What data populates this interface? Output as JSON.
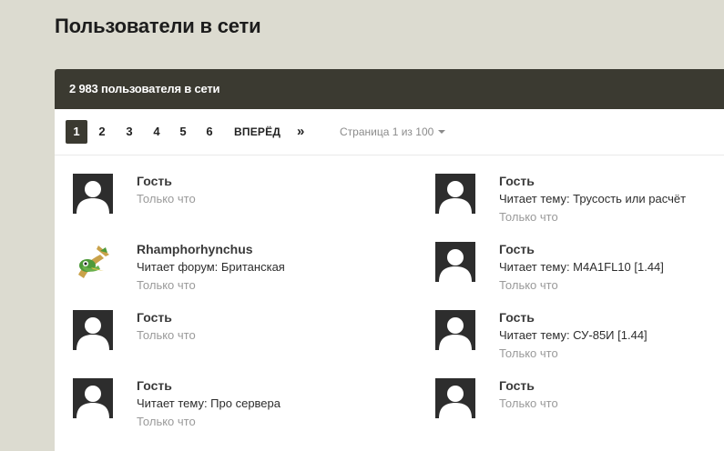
{
  "page_title": "Пользователи в сети",
  "panel": {
    "header": "2 983 пользователя в сети"
  },
  "pagination": {
    "pages": [
      "1",
      "2",
      "3",
      "4",
      "5",
      "6"
    ],
    "active_page": "1",
    "next_label": "ВПЕРЁД",
    "last_label": "»",
    "page_info": "Страница 1 из 100"
  },
  "users": [
    {
      "name": "Гость",
      "activity": "",
      "time": "Только что",
      "avatar": "default-avatar"
    },
    {
      "name": "Гость",
      "activity": "Читает тему: Трусость или расчёт",
      "time": "Только что",
      "avatar": "default-avatar"
    },
    {
      "name": "Rhamphorhynchus",
      "activity": "Читает форум: Британская",
      "time": "Только что",
      "avatar": "custom-avatar"
    },
    {
      "name": "Гость",
      "activity": "Читает тему: M4A1FL10 [1.44]",
      "time": "Только что",
      "avatar": "default-avatar"
    },
    {
      "name": "Гость",
      "activity": "",
      "time": "Только что",
      "avatar": "default-avatar"
    },
    {
      "name": "Гость",
      "activity": "Читает тему: СУ-85И [1.44]",
      "time": "Только что",
      "avatar": "default-avatar"
    },
    {
      "name": "Гость",
      "activity": "Читает тему: Про сервера",
      "time": "Только что",
      "avatar": "default-avatar"
    },
    {
      "name": "Гость",
      "activity": "",
      "time": "Только что",
      "avatar": "default-avatar"
    }
  ]
}
